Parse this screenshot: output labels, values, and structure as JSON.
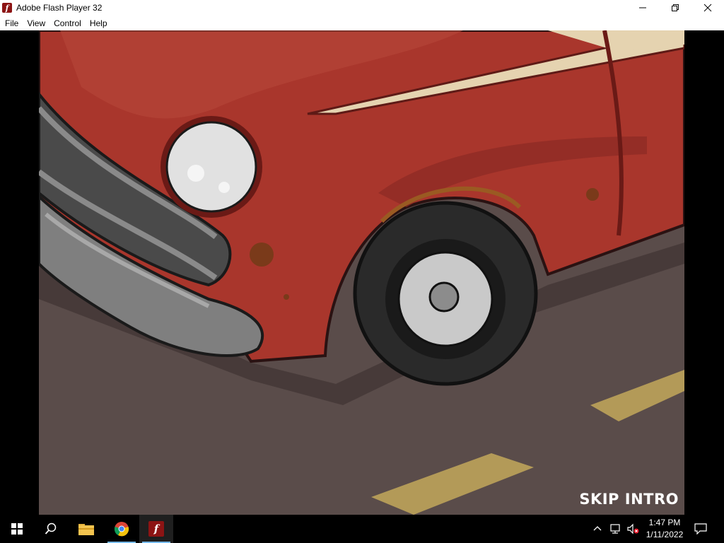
{
  "window": {
    "title": "Adobe Flash Player 32",
    "app_icon": "flash-icon"
  },
  "menu": {
    "items": [
      "File",
      "View",
      "Control",
      "Help"
    ]
  },
  "stage": {
    "skip_label": "SKIP INTRO"
  },
  "taskbar": {
    "apps": [
      "windows-start-icon",
      "search-icon",
      "file-explorer-icon",
      "chrome-icon",
      "flash-player-icon"
    ],
    "clock_time": "1:47 PM",
    "clock_date": "1/11/2022"
  },
  "colors": {
    "car_red": "#a9362c",
    "road": "#5a4c4a",
    "flash_brand": "#8c1414"
  }
}
